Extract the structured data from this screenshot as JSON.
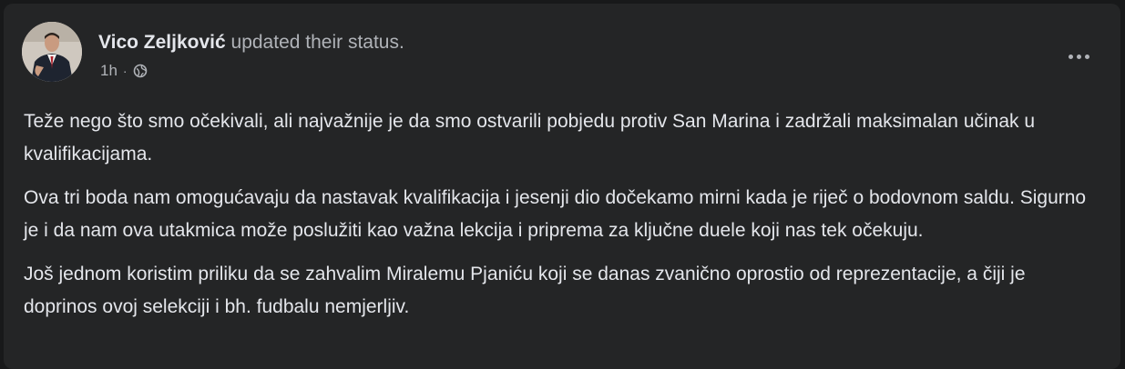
{
  "post": {
    "author": {
      "name": "Vico Zeljković",
      "action": " updated their status."
    },
    "meta": {
      "time": "1h",
      "separator": "·",
      "privacy_icon": "globe-icon"
    },
    "more_icon": "more-horizontal-icon",
    "paragraphs": [
      "Teže nego što smo očekivali, ali najvažnije je da smo ostvarili pobjedu protiv San Marina i zadržali maksimalan učinak u kvalifikacijama.",
      "Ova tri boda nam omogućavaju da nastavak kvalifikacija i jesenji dio dočekamo mirni kada je riječ o bodovnom saldu. Sigurno je i da nam ova utakmica može poslužiti kao važna lekcija i priprema za ključne duele koji nas tek očekuju.",
      "Još jednom koristim priliku da se zahvalim Miralemu Pjaniću koji se danas zvanično oprostio od reprezentacije, a čiji je doprinos ovoj selekciji i bh. fudbalu nemjerljiv."
    ]
  },
  "colors": {
    "page_background": "#18191a",
    "card_background": "#242526",
    "primary_text": "#e4e6eb",
    "secondary_text": "#b0b3b8"
  }
}
